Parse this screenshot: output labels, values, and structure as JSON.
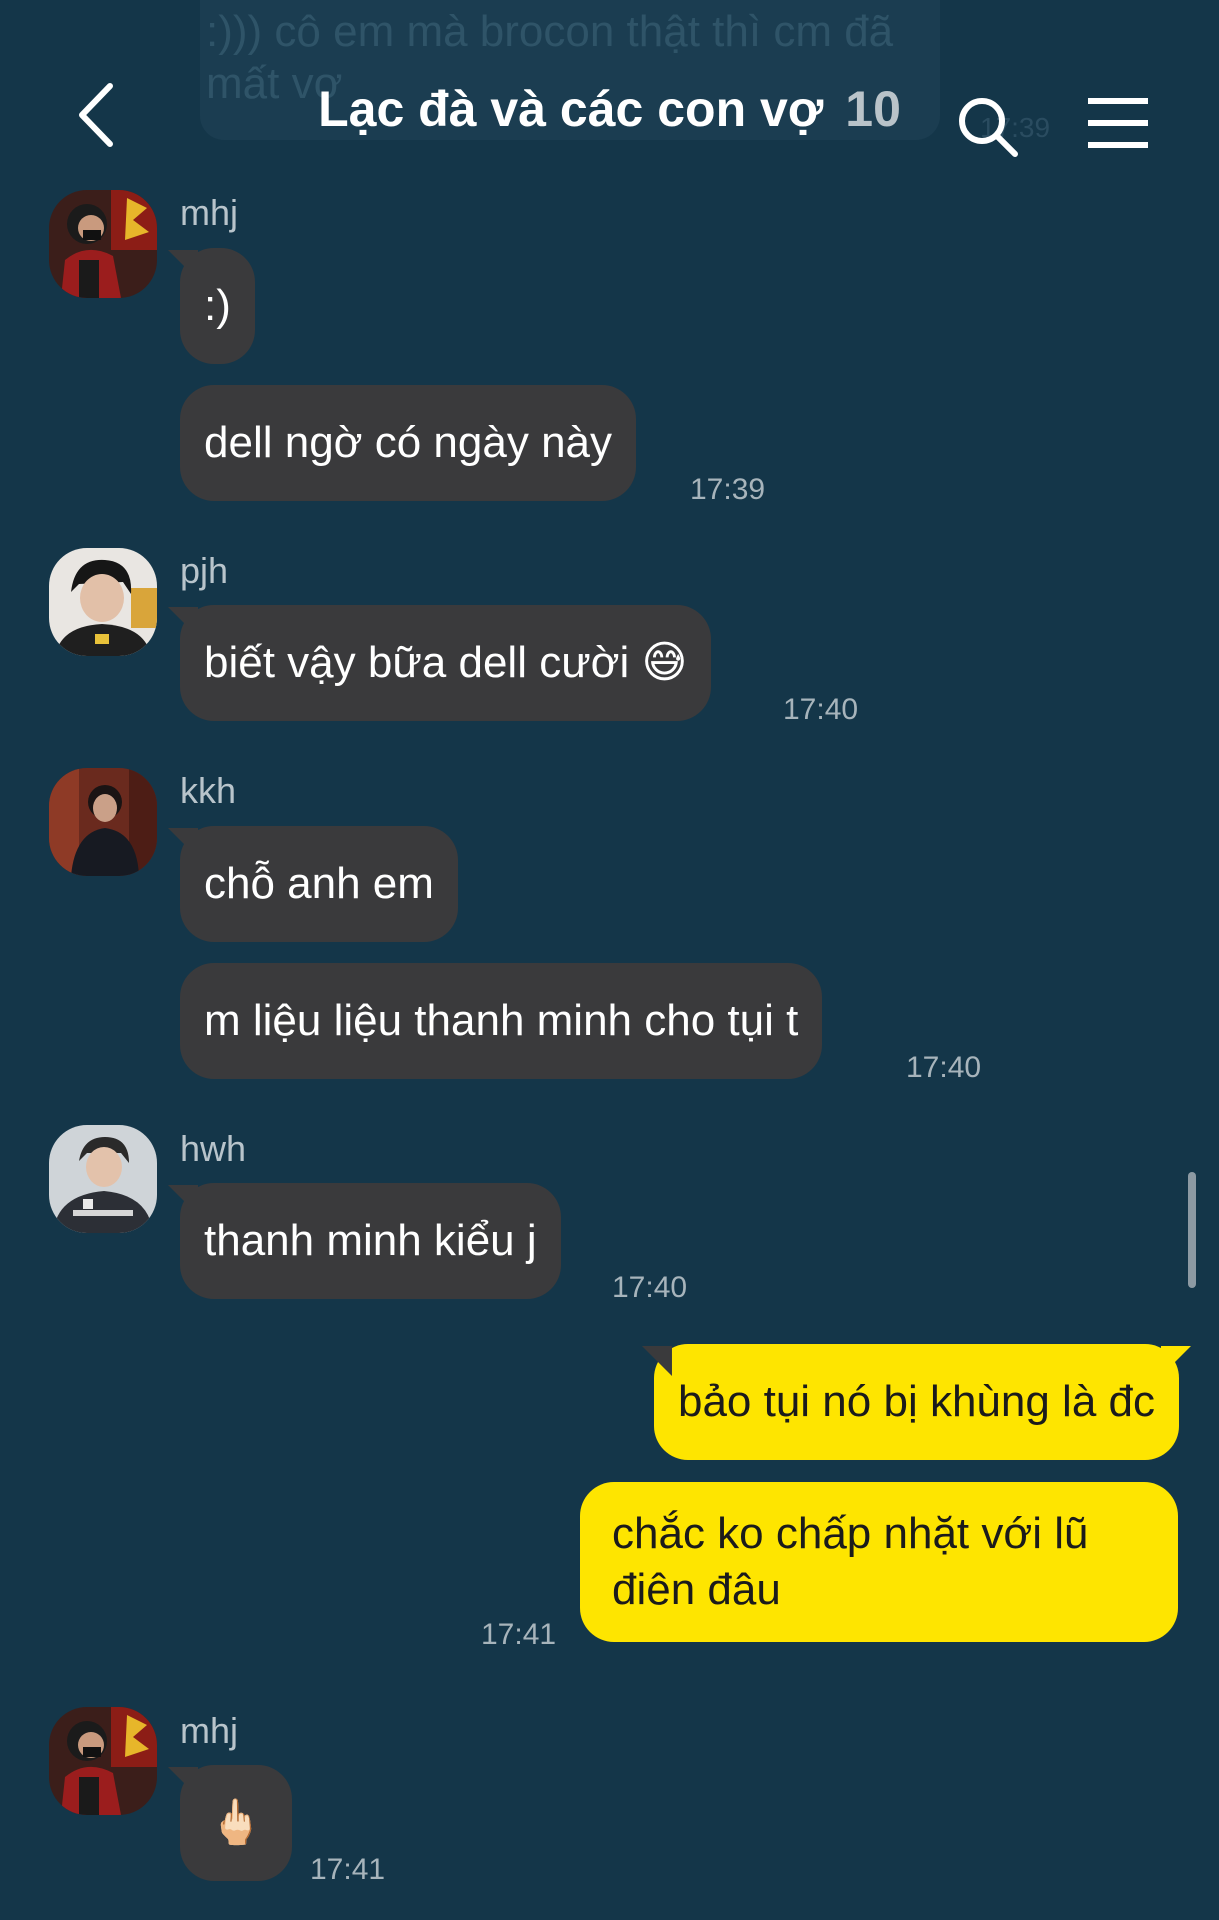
{
  "background_message": {
    "text": ":))) cô em mà brocon thật thì cm đã mất vợ",
    "time": "17:39"
  },
  "header": {
    "title": "Lạc đà và các con vợ",
    "member_count": "10",
    "back_icon": "chevron-left-icon",
    "search_icon": "search-icon",
    "menu_icon": "hamburger-menu-icon"
  },
  "messages": [
    {
      "sender": "mhj",
      "bubbles": [
        ":)",
        "dell ngờ có ngày này"
      ],
      "time": "17:39"
    },
    {
      "sender": "pjh",
      "bubbles": [
        "biết vậy bữa dell cười 😅"
      ],
      "time": "17:40"
    },
    {
      "sender": "kkh",
      "bubbles": [
        "chỗ anh em",
        "m liệu liệu thanh minh cho tụi t"
      ],
      "time": "17:40"
    },
    {
      "sender": "hwh",
      "bubbles": [
        "thanh minh kiểu j"
      ],
      "time": "17:40"
    },
    {
      "sender": "me",
      "bubbles": [
        "bảo tụi nó bị khùng là đc",
        "chắc ko chấp nhặt với lũ điên đâu"
      ],
      "time": "17:41"
    },
    {
      "sender": "mhj",
      "bubbles": [
        "🖕🏻"
      ],
      "time": "17:41"
    }
  ],
  "colors": {
    "background": "#143649",
    "bubble_other": "#3a3a3c",
    "bubble_mine": "#fee500"
  }
}
